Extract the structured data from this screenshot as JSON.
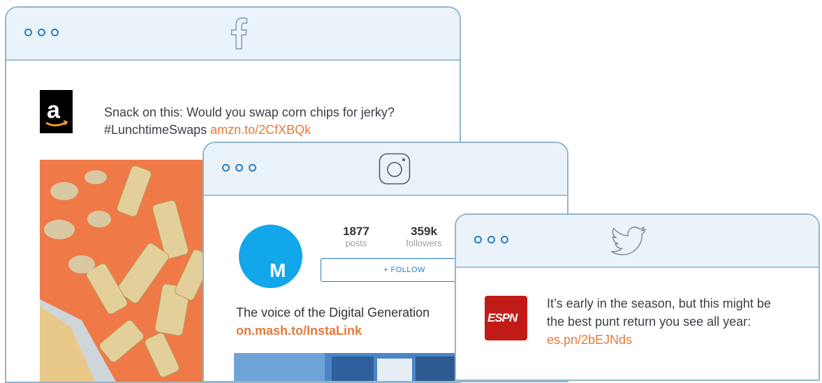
{
  "facebook": {
    "post_text": "Snack on this: Would you swap corn chips for jerky? #LunchtimeSwaps ",
    "post_link": "amzn.to/2CfXBQk",
    "avatar_letter": "a",
    "icon": "facebook-f-icon"
  },
  "instagram": {
    "avatar_letter": "M",
    "posts_count": "1877",
    "posts_label": "posts",
    "followers_count": "359k",
    "followers_label": "followers",
    "follow_button": "+ FOLLOW",
    "bio": "The voice of the Digital Generation",
    "bio_link": "on.mash.to/InstaLink",
    "icon": "instagram-icon"
  },
  "twitter": {
    "tweet_text": "It’s early in the season, but this might be the best punt return you see all year: ",
    "tweet_link": "es.pn/2bEJNds",
    "avatar_text": "ESPN",
    "icon": "twitter-bird-icon"
  },
  "colors": {
    "frame_border": "#8fb6cf",
    "title_bar": "#eaf3fa",
    "link": "#e57a3a",
    "dot": "#2a7dc0"
  }
}
